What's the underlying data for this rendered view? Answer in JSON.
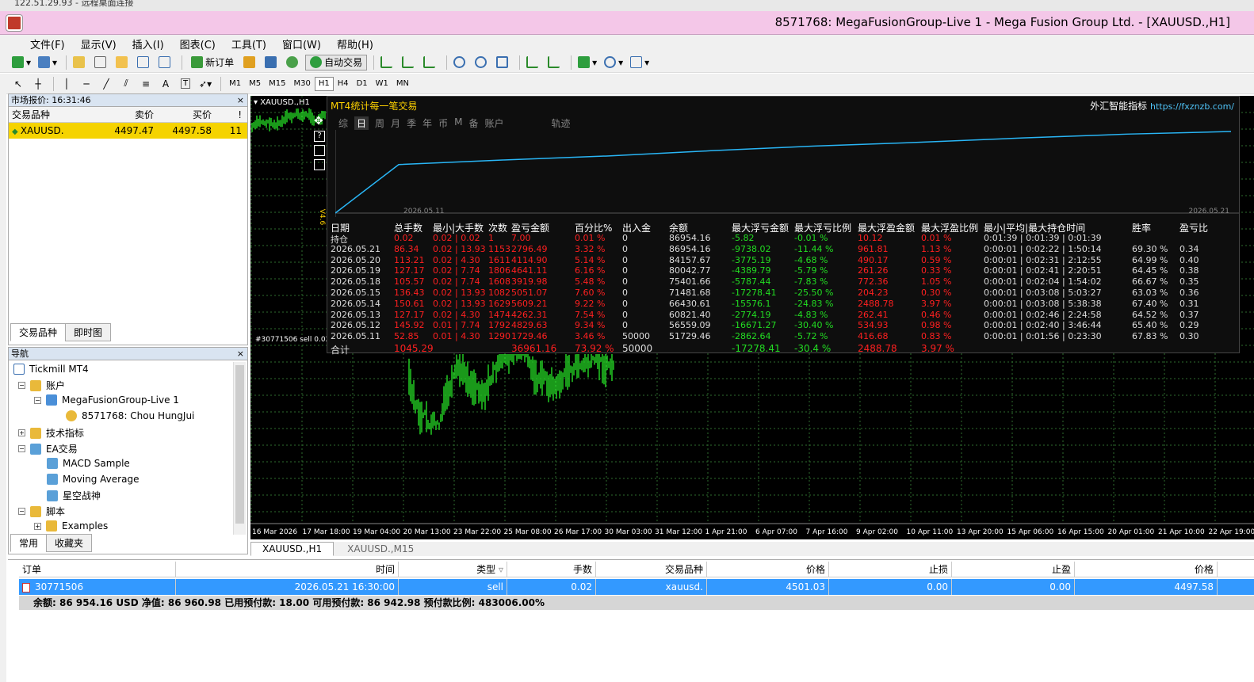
{
  "top_strip": "122.51.29.93 - 远程桌面连接",
  "window": {
    "title": "8571768: MegaFusionGroup-Live 1 - Mega Fusion Group Ltd. - [XAUUSD.,H1]"
  },
  "menu": [
    "文件(F)",
    "显示(V)",
    "插入(I)",
    "图表(C)",
    "工具(T)",
    "窗口(W)",
    "帮助(H)"
  ],
  "toolbar": {
    "new_order": "新订单",
    "auto_trading": "自动交易",
    "draw_text": "A",
    "draw_label": "T"
  },
  "timeframes": [
    "M1",
    "M5",
    "M15",
    "M30",
    "H1",
    "H4",
    "D1",
    "W1",
    "MN"
  ],
  "active_timeframe": "H1",
  "market_watch": {
    "title": "市场报价: 16:31:46",
    "columns": [
      "交易品种",
      "卖价",
      "买价",
      "!"
    ],
    "rows": [
      {
        "symbol": "XAUUSD.",
        "bid": "4497.47",
        "ask": "4497.58",
        "spread": "11"
      }
    ],
    "tabs": [
      "交易品种",
      "即时图"
    ]
  },
  "navigator": {
    "title": "导航",
    "items": {
      "root": "Tickmill MT4",
      "accounts": "账户",
      "server": "MegaFusionGroup-Live 1",
      "account": "8571768: Chou HungJui",
      "indicators": "技术指标",
      "experts": "EA交易",
      "ea1": "MACD Sample",
      "ea2": "Moving Average",
      "ea3": "星空战神",
      "scripts": "脚本",
      "examples": "Examples"
    },
    "tabs": [
      "常用",
      "收藏夹"
    ]
  },
  "chart": {
    "symbol_label": "XAUUSD.,H1",
    "order_label": "#30771506 sell 0.02",
    "side_label": "V4.6",
    "time_axis": [
      "16 Mar 2026",
      "17 Mar 18:00",
      "19 Mar 04:00",
      "20 Mar 13:00",
      "23 Mar 22:00",
      "25 Mar 08:00",
      "26 Mar 17:00",
      "30 Mar 03:00",
      "31 Mar 12:00",
      "1 Apr 21:00",
      "6 Apr 07:00",
      "7 Apr 16:00",
      "9 Apr 02:00",
      "10 Apr 11:00",
      "13 Apr 20:00",
      "15 Apr 06:00",
      "16 Apr 15:00",
      "20 Apr 01:00",
      "21 Apr 10:00",
      "22 Apr 19:00"
    ],
    "tabs": [
      "XAUUSD.,H1",
      "XAUUSD.,M15"
    ],
    "grid_color": "#2e6b2e",
    "candle_color": "#22cc22"
  },
  "stats": {
    "title": "MT4统计每一笔交易",
    "brand": "外汇智能指标",
    "brand_url": "https://fxznzb.com/",
    "tabs": [
      "综",
      "日",
      "周",
      "月",
      "季",
      "年",
      "币",
      "M",
      "备",
      "账户",
      "轨迹"
    ],
    "active_tab": "日",
    "curve_start_label": "2026.05.11",
    "curve_end_label": "2026.05.21",
    "curve_color": "#29b6f6",
    "headers": [
      "日期",
      "总手数",
      "最小|大手数",
      "次数",
      "盈亏金额",
      "百分比%",
      "出入金",
      "余额",
      "最大浮亏金额",
      "最大浮亏比例",
      "最大浮盈金额",
      "最大浮盈比例",
      "最小|平均|最大持仓时间",
      "胜率",
      "盈亏比"
    ],
    "rows": [
      [
        "持仓",
        "0.02",
        "0.02 | 0.02",
        "1",
        "7.00",
        "0.01 %",
        "0",
        "86954.16",
        "-5.82",
        "-0.01 %",
        "10.12",
        "0.01 %",
        "0:01:39 | 0:01:39 | 0:01:39",
        "",
        ""
      ],
      [
        "2026.05.21",
        "86.34",
        "0.02 | 13.93",
        "1153",
        "2796.49",
        "3.32 %",
        "0",
        "86954.16",
        "-9738.02",
        "-11.44 %",
        "961.81",
        "1.13 %",
        "0:00:01 | 0:02:22 | 1:50:14",
        "69.30 %",
        "0.34"
      ],
      [
        "2026.05.20",
        "113.21",
        "0.02 | 4.30",
        "1611",
        "4114.90",
        "5.14 %",
        "0",
        "84157.67",
        "-3775.19",
        "-4.68 %",
        "490.17",
        "0.59 %",
        "0:00:01 | 0:02:31 | 2:12:55",
        "64.99 %",
        "0.40"
      ],
      [
        "2026.05.19",
        "127.17",
        "0.02 | 7.74",
        "1806",
        "4641.11",
        "6.16 %",
        "0",
        "80042.77",
        "-4389.79",
        "-5.79 %",
        "261.26",
        "0.33 %",
        "0:00:01 | 0:02:41 | 2:20:51",
        "64.45 %",
        "0.38"
      ],
      [
        "2026.05.18",
        "105.57",
        "0.02 | 7.74",
        "1608",
        "3919.98",
        "5.48 %",
        "0",
        "75401.66",
        "-5787.44",
        "-7.83 %",
        "772.36",
        "1.05 %",
        "0:00:01 | 0:02:04 | 1:54:02",
        "66.67 %",
        "0.35"
      ],
      [
        "2026.05.15",
        "136.43",
        "0.02 | 13.93",
        "1082",
        "5051.07",
        "7.60 %",
        "0",
        "71481.68",
        "-17278.41",
        "-25.50 %",
        "204.23",
        "0.30 %",
        "0:00:01 | 0:03:08 | 5:03:27",
        "63.03 %",
        "0.36"
      ],
      [
        "2026.05.14",
        "150.61",
        "0.02 | 13.93",
        "1629",
        "5609.21",
        "9.22 %",
        "0",
        "66430.61",
        "-15576.1",
        "-24.83 %",
        "2488.78",
        "3.97 %",
        "0:00:01 | 0:03:08 | 5:38:38",
        "67.40 %",
        "0.31"
      ],
      [
        "2026.05.13",
        "127.17",
        "0.02 | 4.30",
        "1474",
        "4262.31",
        "7.54 %",
        "0",
        "60821.40",
        "-2774.19",
        "-4.83 %",
        "262.41",
        "0.46 %",
        "0:00:01 | 0:02:46 | 2:24:58",
        "64.52 %",
        "0.37"
      ],
      [
        "2026.05.12",
        "145.92",
        "0.01 | 7.74",
        "1792",
        "4829.63",
        "9.34 %",
        "0",
        "56559.09",
        "-16671.27",
        "-30.40 %",
        "534.93",
        "0.98 %",
        "0:00:01 | 0:02:40 | 3:46:44",
        "65.40 %",
        "0.29"
      ],
      [
        "2026.05.11",
        "52.85",
        "0.01 | 4.30",
        "1290",
        "1729.46",
        "3.46 %",
        "50000",
        "51729.46",
        "-2862.64",
        "-5.72 %",
        "416.68",
        "0.83 %",
        "0:00:01 | 0:01:56 | 0:23:30",
        "67.83 %",
        "0.30"
      ]
    ],
    "total": [
      "合计",
      "1045.29",
      "",
      "",
      "36961.16",
      "73.92 %",
      "50000",
      "",
      "-17278.41",
      "-30.4 %",
      "2488.78",
      "3.97 %",
      "",
      "",
      ""
    ]
  },
  "terminal": {
    "columns": [
      "订单",
      "时间",
      "类型",
      "手数",
      "交易品种",
      "价格",
      "止损",
      "止盈",
      "价格"
    ],
    "order": [
      "30771506",
      "2026.05.21 16:30:00",
      "sell",
      "0.02",
      "xauusd.",
      "4501.03",
      "0.00",
      "0.00",
      "4497.58"
    ],
    "balance_line": "余额: 86 954.16 USD  净值: 86 960.98  已用预付款: 18.00  可用预付款: 86 942.98  预付款比例: 483006.00%"
  }
}
